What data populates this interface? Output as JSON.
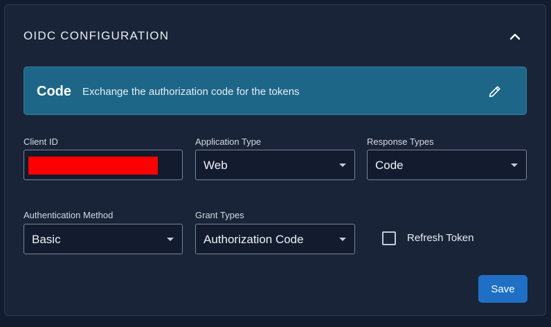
{
  "section": {
    "title": "OIDC CONFIGURATION",
    "collapse_icon": "chevron-up-icon"
  },
  "banner": {
    "title": "Code",
    "description": "Exchange the authorization code for the tokens",
    "edit_icon": "pencil-icon"
  },
  "fields": {
    "client_id": {
      "label": "Client ID",
      "value": ""
    },
    "application_type": {
      "label": "Application Type",
      "value": "Web"
    },
    "response_types": {
      "label": "Response Types",
      "value": "Code"
    },
    "authentication_method": {
      "label": "Authentication Method",
      "value": "Basic"
    },
    "grant_types": {
      "label": "Grant Types",
      "value": "Authorization Code"
    },
    "refresh_token": {
      "label": "Refresh Token",
      "checked": false
    }
  },
  "actions": {
    "save_label": "Save"
  },
  "colors": {
    "background": "#131b2e",
    "card": "#1a2438",
    "banner": "#1e6688",
    "primary_button": "#1f6fc5",
    "redaction": "#ff0000"
  }
}
